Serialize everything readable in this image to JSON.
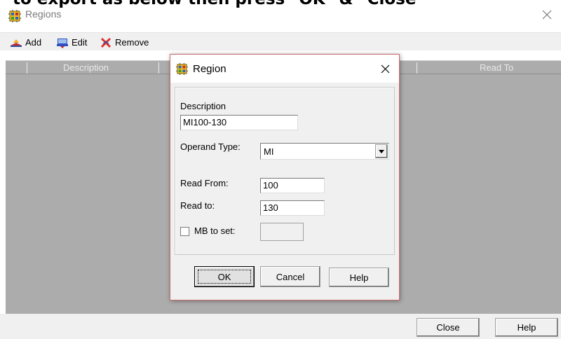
{
  "caption": "to export as below then press \"OK\" & \"Close\"",
  "window": {
    "title": "Regions",
    "icon": "grid-app-icon"
  },
  "toolbar": {
    "add_label": "Add",
    "edit_label": "Edit",
    "remove_label": "Remove"
  },
  "table": {
    "columns": [
      "Description",
      "Read To"
    ]
  },
  "footer": {
    "close_label": "Close",
    "help_label": "Help"
  },
  "dialog": {
    "title": "Region",
    "description_label": "Description",
    "description_value": "MI100-130",
    "operand_type_label": "Operand Type:",
    "operand_type_value": "MI",
    "read_from_label": "Read From:",
    "read_from_value": "100",
    "read_to_label": "Read to:",
    "read_to_value": "130",
    "mb_to_set_label": "MB to set:",
    "mb_to_set_checked": false,
    "ok_label": "OK",
    "cancel_label": "Cancel",
    "help_label": "Help"
  },
  "colors": {
    "list_background": "#acacac",
    "dialog_border": "#c96a6a",
    "dialog_background": "#f0f0f0"
  }
}
